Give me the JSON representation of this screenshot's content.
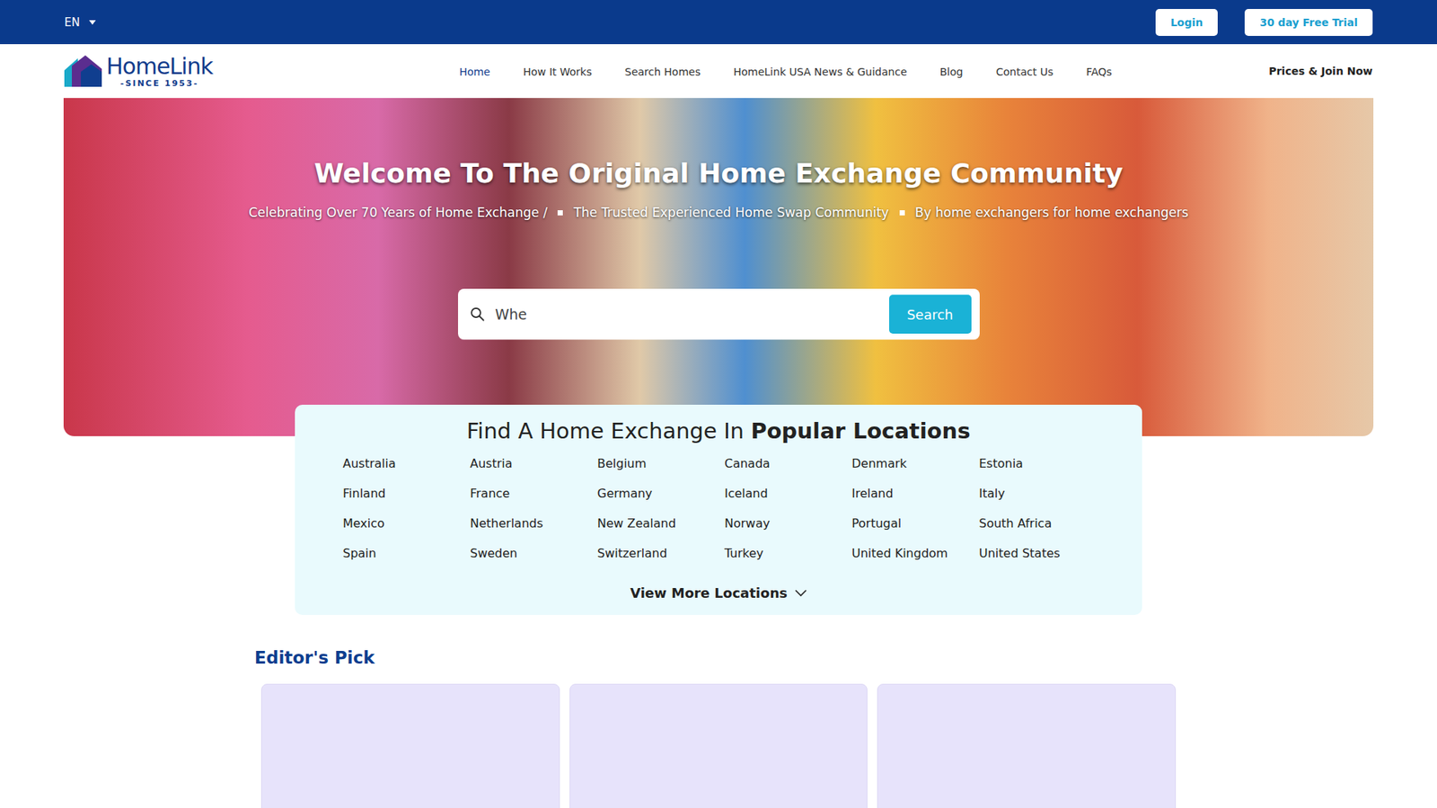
{
  "top_bar": {
    "language": "EN",
    "buttons": [
      "Login",
      "30 day Free Trial"
    ]
  },
  "logo": {
    "name": "HomeLink",
    "tagline": "-SINCE 1953-"
  },
  "nav": {
    "items": [
      {
        "label": "Home",
        "selected": true
      },
      {
        "label": "How It Works",
        "selected": false
      },
      {
        "label": "Search Homes",
        "selected": false
      },
      {
        "label": "HomeLink USA News & Guidance",
        "selected": false
      },
      {
        "label": "Blog",
        "selected": false
      },
      {
        "label": "Contact Us",
        "selected": false
      },
      {
        "label": "FAQs",
        "selected": false
      }
    ],
    "cta": "Prices & Join Now"
  },
  "hero": {
    "title": "Welcome To The Original Home Exchange Community",
    "subtitles": [
      "Celebrating Over 70 Years of Home Exchange /",
      "The Trusted Experienced Home Swap Community",
      "By home exchangers for home exchangers"
    ]
  },
  "search": {
    "placeholder": "Whe",
    "button": "Search"
  },
  "locations": {
    "heading_light": "Find A Home Exchange In ",
    "heading_bold": "Popular Locations",
    "items": [
      "Australia",
      "Austria",
      "Belgium",
      "Canada",
      "Denmark",
      "Estonia",
      "Finland",
      "France",
      "Germany",
      "Iceland",
      "Ireland",
      "Italy",
      "Mexico",
      "Netherlands",
      "New Zealand",
      "Norway",
      "Portugal",
      "South Africa",
      "Spain",
      "Sweden",
      "Switzerland",
      "Turkey",
      "United Kingdom",
      "United States"
    ],
    "more": "View More Locations"
  },
  "editors_pick": {
    "title": "Editor's Pick",
    "cards": [
      {},
      {},
      {}
    ]
  }
}
